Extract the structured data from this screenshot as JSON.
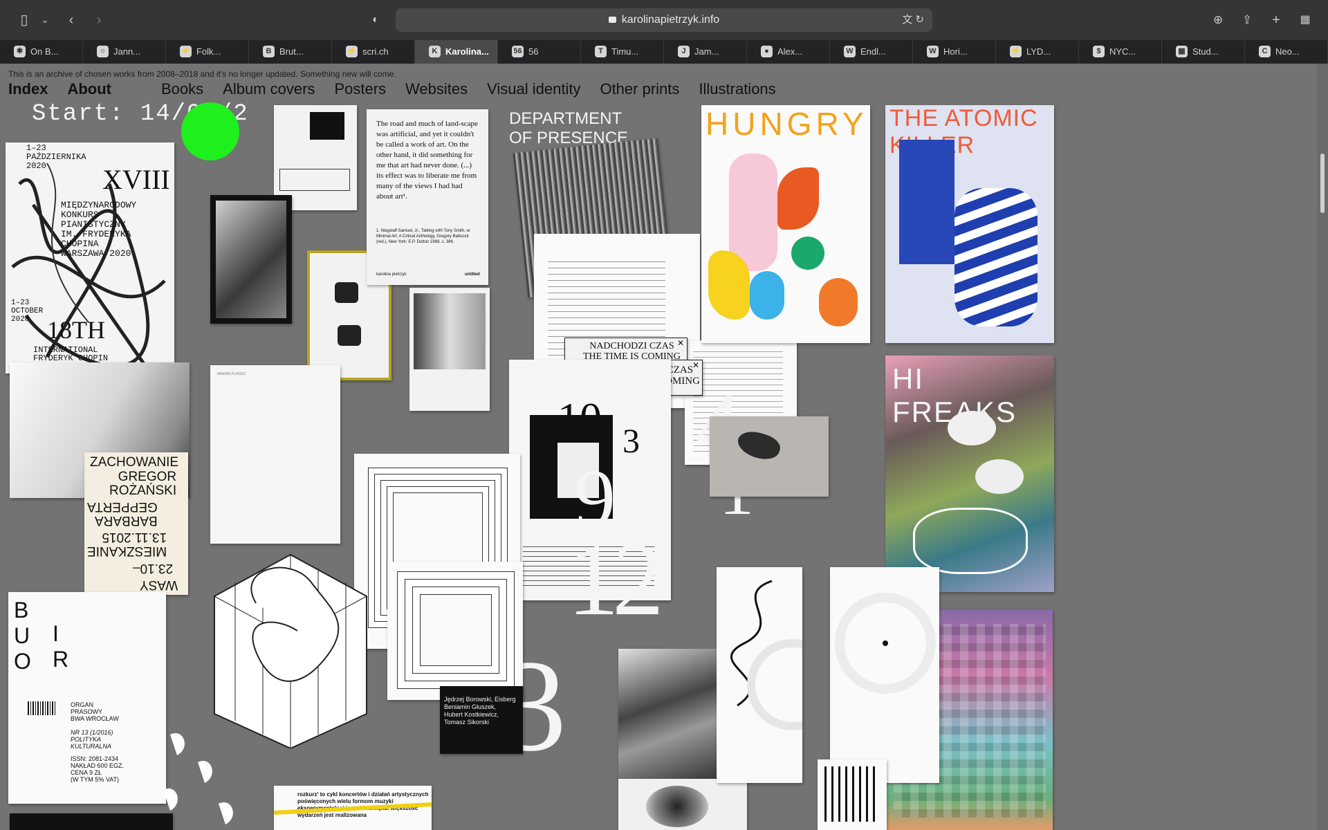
{
  "browser": {
    "url": "karolinapietrzyk.info",
    "tabs": [
      {
        "label": "On B...",
        "fav": "✱"
      },
      {
        "label": "Jann...",
        "fav": "○"
      },
      {
        "label": "Folk...",
        "fav": "⚡"
      },
      {
        "label": "Brut...",
        "fav": "B"
      },
      {
        "label": "scri.ch",
        "fav": "⚡"
      },
      {
        "label": "Karolina...",
        "fav": "K"
      },
      {
        "label": "56",
        "fav": "56"
      },
      {
        "label": "Timu...",
        "fav": "T"
      },
      {
        "label": "Jam...",
        "fav": "J"
      },
      {
        "label": "Alex...",
        "fav": "●"
      },
      {
        "label": "Endl...",
        "fav": "W"
      },
      {
        "label": "Hori...",
        "fav": "W"
      },
      {
        "label": "LYD...",
        "fav": "⚡"
      },
      {
        "label": "NYC...",
        "fav": "$"
      },
      {
        "label": "Stud...",
        "fav": "▦"
      },
      {
        "label": "Neo...",
        "fav": "C"
      }
    ]
  },
  "site": {
    "notice": "This is an archive of chosen works from 2008–2018 and it's no longer updated. Something new will come.",
    "nav": [
      "Index",
      "About",
      "Books",
      "Album covers",
      "Posters",
      "Websites",
      "Visual identity",
      "Other prints",
      "Illustrations"
    ],
    "start_label": "Start: 14/02/2",
    "works": {
      "chopin": {
        "dates": "1–23\nPAŹDZIERNIKA\n2020",
        "numeral": "XVIII",
        "title": "MIĘDZYNARODOWY\nKONKURS\nPIANISTYCZNY\nIM. FRYDERYKA\nCHOPINA\nWARSZAWA 2020",
        "en_date": "1–23\nOCTOBER\n2020",
        "en_num": "18TH",
        "en_title": "INTERNATIONAL\nFRYDERYK CHOPIN\nPIANO COMPETITION"
      },
      "quote": {
        "text": "The road and much of land-scape was artificial, and yet it couldn't be called a work of art. On the other hand, it did something for me that art had never done. (...) its effect was to liberate me from many of the views I had had about art¹.",
        "footnote": "1. Wagstaff Samuel, Jr., Talking with Tony Smith, w: Minimal Art: A Critical Anthology, Gregory Battcock (red.), New York: E.P. Dutton 1968, s. 386.",
        "author": "karolina pietrzyk",
        "tag": "untitled"
      },
      "department": "DEPARTMENT\nOF PRESENCE",
      "nadchodzi_1": "NADCHODZI CZAS\nTHE TIME IS COMING",
      "nadchodzi_2": "NADCHODZI CZAS\nTHE TIME IS COMING",
      "numbers": [
        "4",
        "12",
        "3",
        "10",
        "9",
        "1",
        "3"
      ],
      "hungry": "HUNGRY",
      "atomic": "THE ATOMIC KILLER",
      "freaks": "HI FREAKS",
      "zachowanie": {
        "line1": "ZACHOWANIE",
        "line2": "GREGOR\nROŻAŃSKI",
        "line3": "BARBARA\nGEPPERTA",
        "line4": "MIESZKANIE\n13.11.2015",
        "line5": "23.10–",
        "line6": "WASY"
      },
      "biuro": {
        "title_top": "B U O",
        "title_bottom": "I R",
        "organ": "ORGAN\nPRASOWY\nBWA WROCŁAW",
        "issue": "NR 13 (1/2016)\nPOLITYKA\nKULTURALNA",
        "issn": "ISSN: 2081-2434\nNAKŁAD 600 EGZ.\nCENA 9 ZŁ\n(W TYM 5% VAT)"
      },
      "authors": "Jędrzej Borowski, Eisberg\nBeniamin Głuszek,\nHubert Kostkiewicz,\nTomasz Sikorski",
      "rozkurz": "rozkurz' to cykl koncertów i działań artystycznych poświęconych wielu formom muzyki eksperymentalnej i sztuki dźwięku. większość wydarzeń jest realizowana",
      "making_places": "MAKING PLACES"
    }
  }
}
